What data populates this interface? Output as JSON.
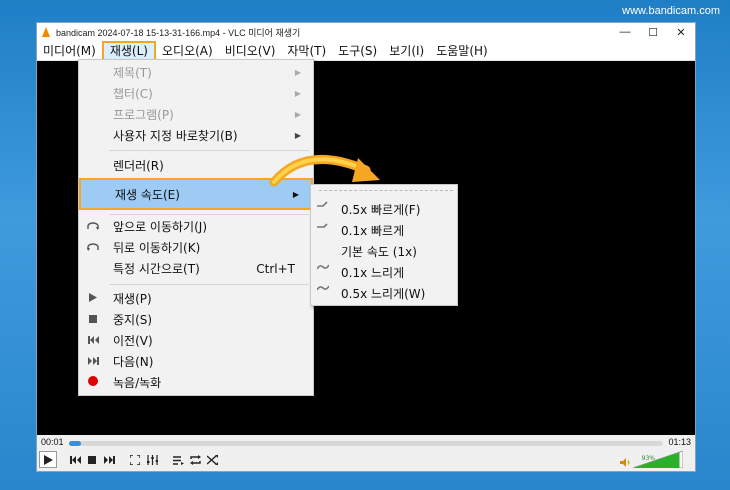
{
  "watermark": "www.bandicam.com",
  "window": {
    "title": "bandicam 2024-07-18 15-13-31-166.mp4 - VLC 미디어 재생기",
    "minimize": "—",
    "maximize": "☐",
    "close": "✕"
  },
  "menubar": [
    {
      "label": "미디어(M)",
      "active": false
    },
    {
      "label": "재생(L)",
      "active": true
    },
    {
      "label": "오디오(A)",
      "active": false
    },
    {
      "label": "비디오(V)",
      "active": false
    },
    {
      "label": "자막(T)",
      "active": false
    },
    {
      "label": "도구(S)",
      "active": false
    },
    {
      "label": "보기(I)",
      "active": false
    },
    {
      "label": "도움말(H)",
      "active": false
    }
  ],
  "playback_menu": {
    "title": "제목(T)",
    "chapter": "챕터(C)",
    "program": "프로그램(P)",
    "custom_bookmarks": "사용자 지정 바로찾기(B)",
    "renderer": "렌더러(R)",
    "speed": "재생 속도(E)",
    "jump_forward": "앞으로 이동하기(J)",
    "jump_backward": "뒤로 이동하기(K)",
    "jump_time": "특정 시간으로(T)",
    "jump_time_shortcut": "Ctrl+T",
    "play": "재생(P)",
    "stop": "중지(S)",
    "previous": "이전(V)",
    "next": "다음(N)",
    "record": "녹음/녹화"
  },
  "speed_menu": {
    "faster": "0.5x 빠르게(F)",
    "faster_fine": "0.1x 빠르게",
    "normal": "기본 속도 (1x)",
    "slower_fine": "0.1x 느리게",
    "slower": "0.5x 느리게(W)"
  },
  "player": {
    "elapsed": "00:01",
    "total": "01:13",
    "progress": 0.02,
    "volume_label": "93%",
    "volume": 0.93
  },
  "colors": {
    "highlight": "#9dcbf3",
    "callout": "#f5a623",
    "record": "#e00000",
    "seek": "#3b8fd8",
    "volume": "#2bb02b"
  }
}
